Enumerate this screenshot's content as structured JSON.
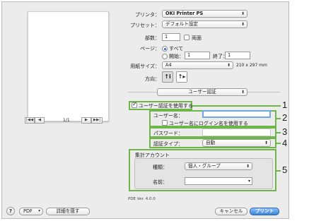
{
  "printer": {
    "label": "プリンタ：",
    "value": "OKI Printer PS"
  },
  "preset": {
    "label": "プリセット：",
    "value": "デフォルト設定"
  },
  "copies": {
    "label": "部数：",
    "value": "1",
    "duplex_label": "両面"
  },
  "pages": {
    "label": "ページ：",
    "all_label": "すべて",
    "from_label": "開始：",
    "from_value": "1",
    "to_label": "終了：",
    "to_value": "1"
  },
  "paper_size": {
    "label": "用紙サイズ：",
    "value": "A4",
    "dims": "210 x 297 mm"
  },
  "orientation": {
    "label": "方向：",
    "portrait_glyph": "↑i",
    "landscape_glyph": "↑▸"
  },
  "panel_select": {
    "value": "ユーザー認証"
  },
  "preview_nav": {
    "first": "|◀◀",
    "prev": "◀",
    "page_indicator": "1/1",
    "next": "▶",
    "last": "▶▶|"
  },
  "user_auth": {
    "use_label": "ユーザー認証を使用する",
    "username_label": "ユーザー名：",
    "username_value": "",
    "use_login_label": "ユーザー名にログイン名を使用する",
    "password_label": "パスワード：",
    "password_value": "",
    "auth_type_label": "認証タイプ：",
    "auth_type_value": "自動"
  },
  "accounting": {
    "title": "集計アカウント",
    "kind_label": "種類：",
    "kind_value": "個人・グループ",
    "name_label": "名前："
  },
  "pde_version": "PDE Ver. 4.0.0",
  "footer": {
    "help": "?",
    "pdf_label": "PDF",
    "hide_details": "詳細を隠す",
    "cancel": "キャンセル",
    "print": "プリント"
  },
  "callouts": [
    "1",
    "2",
    "3",
    "4",
    "5"
  ],
  "colors": {
    "highlight": "#6fb547",
    "accent": "#3b84d8"
  }
}
